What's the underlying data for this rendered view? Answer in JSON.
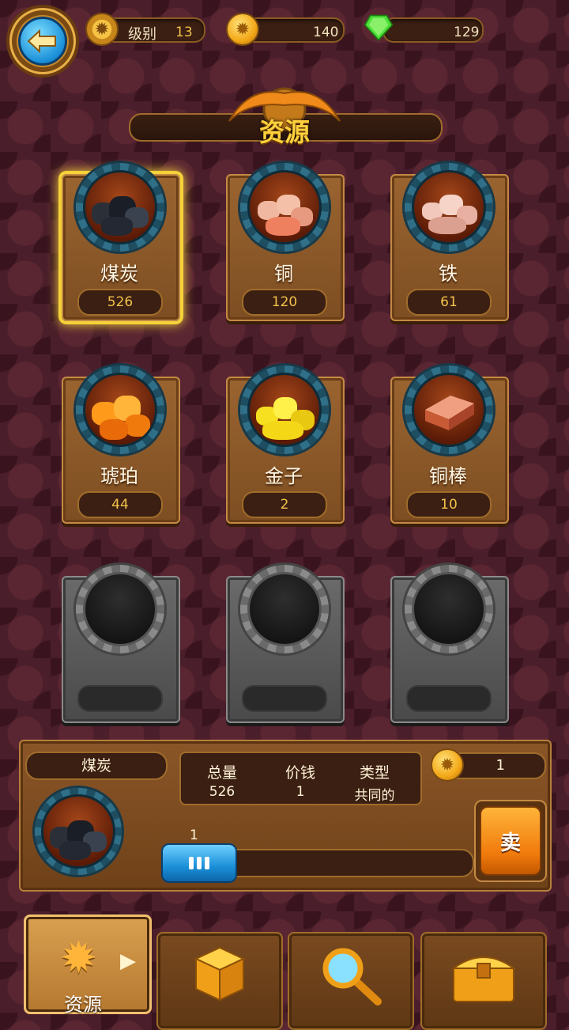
{
  "header": {
    "level_label": "级别",
    "level_value": "13",
    "coins": "140",
    "gems": "129"
  },
  "title": "资源",
  "resources": [
    {
      "name": "煤炭",
      "count": "526"
    },
    {
      "name": "铜",
      "count": "120"
    },
    {
      "name": "铁",
      "count": "61"
    },
    {
      "name": "琥珀",
      "count": "44"
    },
    {
      "name": "金子",
      "count": "2"
    },
    {
      "name": "铜棒",
      "count": "10"
    }
  ],
  "detail": {
    "selected_name": "煤炭",
    "headers": {
      "total": "总量",
      "price": "价钱",
      "type": "类型"
    },
    "values": {
      "total": "526",
      "price": "1",
      "type": "共同的"
    },
    "sell_price": "1",
    "slider_value": "1",
    "sell_label": "卖"
  },
  "tabs": {
    "resources_label": "资源"
  },
  "colors": {
    "background": "#4a1e2a",
    "accent_yellow": "#f2c14a",
    "selection_glow": "#f5d23a"
  },
  "icons": [
    "back-arrow-icon",
    "gear-icon",
    "coin-icon",
    "gem-icon",
    "gear-icon",
    "dice-icon",
    "magnifier-icon",
    "chest-icon"
  ]
}
